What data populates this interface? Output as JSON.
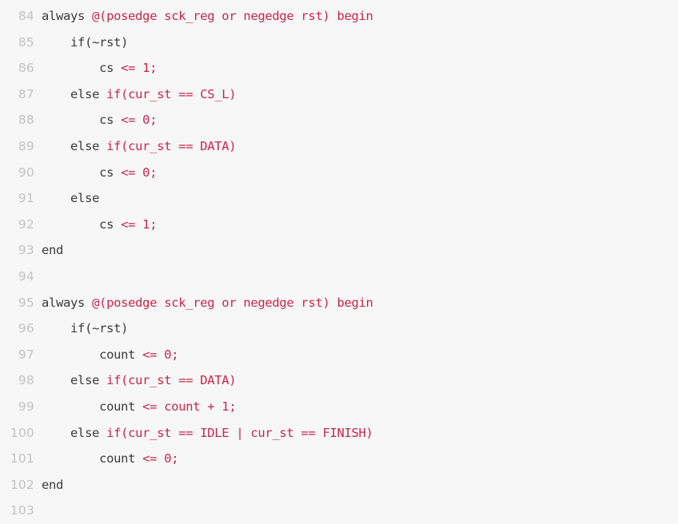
{
  "editor": {
    "name": "code-viewer",
    "language": "verilog",
    "background_color": "#f7f7f7",
    "line_number_color": "#c3c3c3",
    "plain_text_color": "#3a3a3a",
    "highlight_color": "#c7254e",
    "first_line_number": 84,
    "last_line_number": 103
  },
  "lines": [
    {
      "number": "84",
      "tokens": [
        {
          "t": "always ",
          "c": "plain"
        },
        {
          "t": "@(posedge sck_reg or negedge rst) begin",
          "c": "hl"
        }
      ]
    },
    {
      "number": "85",
      "tokens": [
        {
          "t": "    if(~rst)",
          "c": "plain"
        }
      ]
    },
    {
      "number": "86",
      "tokens": [
        {
          "t": "        cs ",
          "c": "plain"
        },
        {
          "t": "<= 1;",
          "c": "hl"
        }
      ]
    },
    {
      "number": "87",
      "tokens": [
        {
          "t": "    else ",
          "c": "plain"
        },
        {
          "t": "if(cur_st == CS_L)",
          "c": "hl"
        }
      ]
    },
    {
      "number": "88",
      "tokens": [
        {
          "t": "        cs ",
          "c": "plain"
        },
        {
          "t": "<= 0;",
          "c": "hl"
        }
      ]
    },
    {
      "number": "89",
      "tokens": [
        {
          "t": "    else ",
          "c": "plain"
        },
        {
          "t": "if(cur_st == DATA)",
          "c": "hl"
        }
      ]
    },
    {
      "number": "90",
      "tokens": [
        {
          "t": "        cs ",
          "c": "plain"
        },
        {
          "t": "<= 0;",
          "c": "hl"
        }
      ]
    },
    {
      "number": "91",
      "tokens": [
        {
          "t": "    else",
          "c": "plain"
        }
      ]
    },
    {
      "number": "92",
      "tokens": [
        {
          "t": "        cs ",
          "c": "plain"
        },
        {
          "t": "<= 1;",
          "c": "hl"
        }
      ]
    },
    {
      "number": "93",
      "tokens": [
        {
          "t": "end",
          "c": "plain"
        }
      ]
    },
    {
      "number": "94",
      "tokens": [
        {
          "t": "",
          "c": "plain"
        }
      ]
    },
    {
      "number": "95",
      "tokens": [
        {
          "t": "always ",
          "c": "plain"
        },
        {
          "t": "@(posedge sck_reg or negedge rst) begin",
          "c": "hl"
        }
      ]
    },
    {
      "number": "96",
      "tokens": [
        {
          "t": "    if(~rst)",
          "c": "plain"
        }
      ]
    },
    {
      "number": "97",
      "tokens": [
        {
          "t": "        count ",
          "c": "plain"
        },
        {
          "t": "<= 0;",
          "c": "hl"
        }
      ]
    },
    {
      "number": "98",
      "tokens": [
        {
          "t": "    else ",
          "c": "plain"
        },
        {
          "t": "if(cur_st == DATA)",
          "c": "hl"
        }
      ]
    },
    {
      "number": "99",
      "tokens": [
        {
          "t": "        count ",
          "c": "plain"
        },
        {
          "t": "<= count + 1;",
          "c": "hl"
        }
      ]
    },
    {
      "number": "100",
      "tokens": [
        {
          "t": "    else ",
          "c": "plain"
        },
        {
          "t": "if(cur_st == IDLE | cur_st == FINISH)",
          "c": "hl"
        }
      ]
    },
    {
      "number": "101",
      "tokens": [
        {
          "t": "        count ",
          "c": "plain"
        },
        {
          "t": "<= 0;",
          "c": "hl"
        }
      ]
    },
    {
      "number": "102",
      "tokens": [
        {
          "t": "end",
          "c": "plain"
        }
      ]
    },
    {
      "number": "103",
      "tokens": [
        {
          "t": "",
          "c": "plain"
        }
      ]
    }
  ]
}
